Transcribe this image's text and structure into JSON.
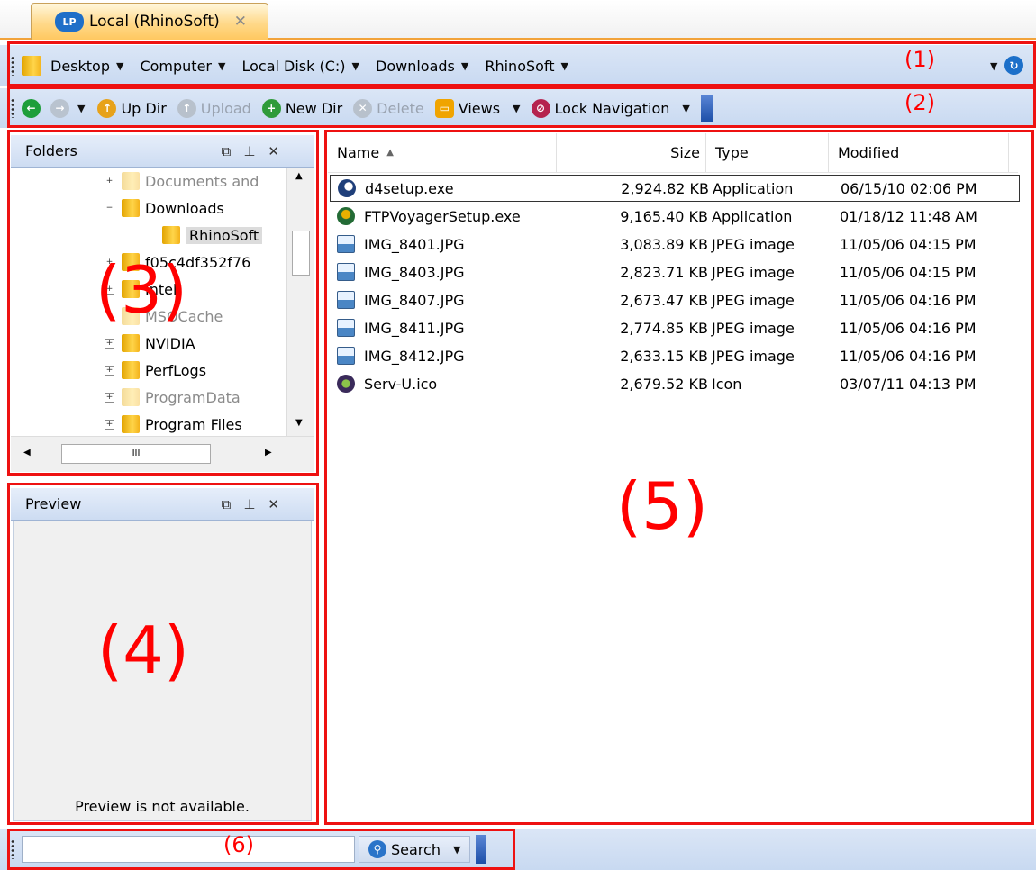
{
  "tab": {
    "label": "Local (RhinoSoft)",
    "close": "✕",
    "icon_text": "LP"
  },
  "address_bar": {
    "crumbs": [
      "Desktop",
      "Computer",
      "Local Disk (C:)",
      "Downloads",
      "RhinoSoft"
    ],
    "annotation": "(1)"
  },
  "toolbar": {
    "up_dir": "Up Dir",
    "upload": "Upload",
    "new_dir": "New Dir",
    "delete": "Delete",
    "views": "Views",
    "lock_navigation": "Lock Navigation",
    "annotation": "(2)"
  },
  "folders_panel": {
    "title": "Folders",
    "annotation": "(3)",
    "tree": [
      "Documents and",
      "Downloads",
      "RhinoSoft",
      "f05c4df352f76",
      "Intel",
      "MSOCache",
      "NVIDIA",
      "PerfLogs",
      "ProgramData",
      "Program Files"
    ],
    "hscroll_thumb": "III"
  },
  "preview_panel": {
    "title": "Preview",
    "message": "Preview is not available.",
    "annotation": "(4)"
  },
  "file_list": {
    "annotation": "(5)",
    "columns": {
      "name": "Name",
      "size": "Size",
      "type": "Type",
      "modified": "Modified"
    },
    "rows": [
      {
        "name": "d4setup.exe",
        "size": "2,924.82 KB",
        "type": "Application",
        "modified": "06/15/10 02:06 PM"
      },
      {
        "name": "FTPVoyagerSetup.exe",
        "size": "9,165.40 KB",
        "type": "Application",
        "modified": "01/18/12 11:48 AM"
      },
      {
        "name": "IMG_8401.JPG",
        "size": "3,083.89 KB",
        "type": "JPEG image",
        "modified": "11/05/06 04:15 PM"
      },
      {
        "name": "IMG_8403.JPG",
        "size": "2,823.71 KB",
        "type": "JPEG image",
        "modified": "11/05/06 04:15 PM"
      },
      {
        "name": "IMG_8407.JPG",
        "size": "2,673.47 KB",
        "type": "JPEG image",
        "modified": "11/05/06 04:16 PM"
      },
      {
        "name": "IMG_8411.JPG",
        "size": "2,774.85 KB",
        "type": "JPEG image",
        "modified": "11/05/06 04:16 PM"
      },
      {
        "name": "IMG_8412.JPG",
        "size": "2,633.15 KB",
        "type": "JPEG image",
        "modified": "11/05/06 04:16 PM"
      },
      {
        "name": "Serv-U.ico",
        "size": "2,679.52 KB",
        "type": "Icon",
        "modified": "03/07/11 04:13 PM"
      }
    ]
  },
  "bottom_bar": {
    "search_value": "",
    "search_label": "Search",
    "annotation": "(6)"
  },
  "colors": {
    "annotation_red": "#ff0000",
    "toolbar_blue": "#c8d9f1",
    "tab_orange": "#ffc860"
  }
}
